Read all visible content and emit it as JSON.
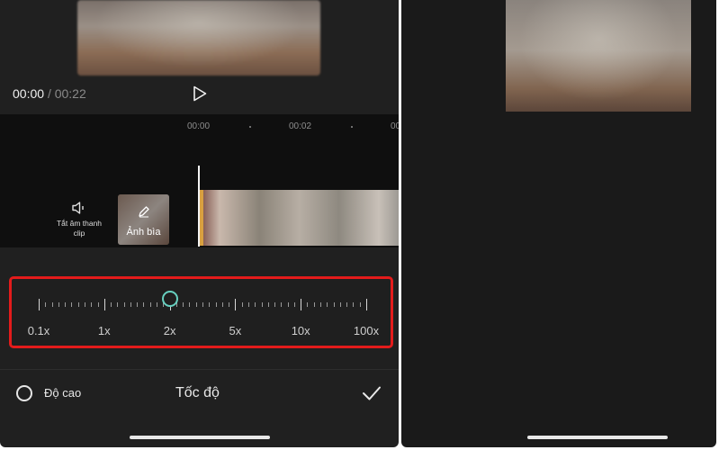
{
  "player": {
    "current_time": "00:00",
    "separator": "/",
    "total_time": "00:22"
  },
  "timeline": {
    "ruler": [
      "00:00",
      "00:02",
      "00"
    ],
    "mute_label": "Tắt âm thanh clip",
    "cover_label": "Ảnh bìa"
  },
  "speed": {
    "options": [
      "0.1x",
      "1x",
      "2x",
      "5x",
      "10x",
      "100x"
    ],
    "selected": "2x",
    "selected_index": 2,
    "accent_color": "#67d0c0",
    "highlight_color": "#e31b1b"
  },
  "footer": {
    "radio_label": "Độ cao",
    "title": "Tốc độ"
  },
  "icons": {
    "play": "play-icon",
    "mute": "speaker-icon",
    "cover": "pencil-icon",
    "confirm": "checkmark-icon"
  }
}
